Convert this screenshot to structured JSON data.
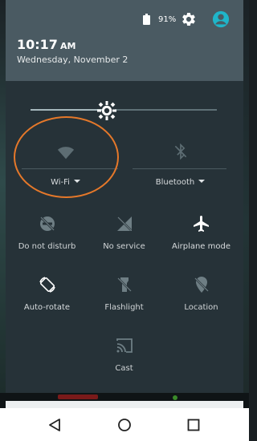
{
  "status_bar": {
    "battery_pct": "91%",
    "icons": [
      "battery-icon",
      "settings-icon",
      "account-icon"
    ]
  },
  "header": {
    "time": "10:17",
    "ampm": "AM",
    "date": "Wednesday, November 2"
  },
  "brightness": {
    "level": 0.45
  },
  "tiles": {
    "wifi": {
      "label": "Wi-Fi",
      "icon": "wifi-icon"
    },
    "bluetooth": {
      "label": "Bluetooth",
      "icon": "bluetooth-off-icon"
    },
    "dnd": {
      "label": "Do not disturb",
      "icon": "do-not-disturb-icon"
    },
    "service": {
      "label": "No service",
      "icon": "no-service-icon"
    },
    "airplane": {
      "label": "Airplane mode",
      "icon": "airplane-icon"
    },
    "rotate": {
      "label": "Auto-rotate",
      "icon": "auto-rotate-icon"
    },
    "flashlight": {
      "label": "Flashlight",
      "icon": "flashlight-icon"
    },
    "location": {
      "label": "Location",
      "icon": "location-off-icon"
    },
    "cast": {
      "label": "Cast",
      "icon": "cast-icon"
    }
  },
  "colors": {
    "header_bg": "#4a5a62",
    "panel_bg": "#263238",
    "highlight": "#e5782a",
    "account_accent": "#1fb5c9"
  },
  "navbar": {
    "icons": [
      "back-icon",
      "home-icon",
      "recent-apps-icon"
    ]
  }
}
